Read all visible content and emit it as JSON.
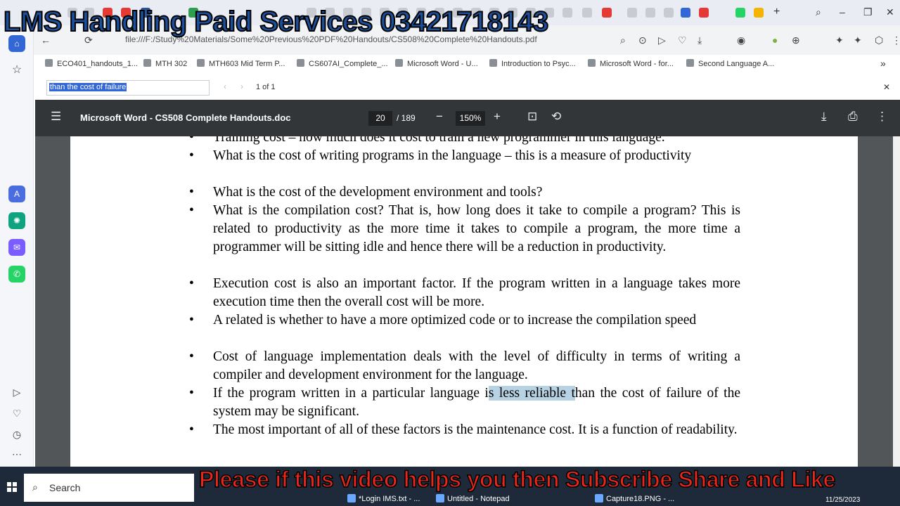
{
  "browser": {
    "address": "file:///F:/Study%20Materials/Some%20Previous%20PDF%20Handouts/CS508%20Complete%20Handouts.pdf",
    "bookmarks": [
      "ECO401_handouts_1...",
      "MTH 302",
      "MTH603 Mid Term P...",
      "CS607AI_Complete_...",
      "Microsoft Word - U...",
      "Introduction to Psyc...",
      "Microsoft Word - for...",
      "Second Language A..."
    ]
  },
  "find_bar": {
    "query": "than the cost of failure",
    "count": "1 of 1"
  },
  "pdf_viewer": {
    "title": "Microsoft Word - CS508 Complete Handouts.doc",
    "page_current": "20",
    "page_total": "/ 189",
    "zoom": "150%"
  },
  "document": {
    "bullets": [
      "Training cost – how much does it cost to train a new programmer in this language.",
      "What is the cost of writing programs in the language – this is a measure of productivity",
      "What is the cost of the development environment and tools?",
      "What is the compilation cost? That is, how long does it take to compile a program? This is related to productivity as the more time it takes to compile a program, the more time a programmer will be sitting idle and hence there will be a reduction in productivity.",
      "Execution cost is also an important factor. If the program written in a language takes more execution time then the overall cost will be more.",
      "A related is whether to have a more optimized code or to increase the compilation speed",
      "Cost of language implementation deals with the level of difficulty in terms of writing a compiler and development environment for the language."
    ],
    "bullet_highlight": {
      "before": "If the program written in a particular language i",
      "highlighted": "s less reliable t",
      "after": "han the cost of failure of the system may be significant."
    },
    "last_bullet": "The most important of all of these factors is the maintenance cost. It is a function of readability."
  },
  "overlays": {
    "top": "LMS Handling Paid Services 03421718143",
    "bottom": "Please if this video helps you then Subscribe Share and Like"
  },
  "taskbar": {
    "search": "Search",
    "apps": [
      "*Login IMS.txt - ...",
      "Untitled - Notepad",
      "Capture18.PNG - ..."
    ],
    "date": "11/25/2023"
  }
}
